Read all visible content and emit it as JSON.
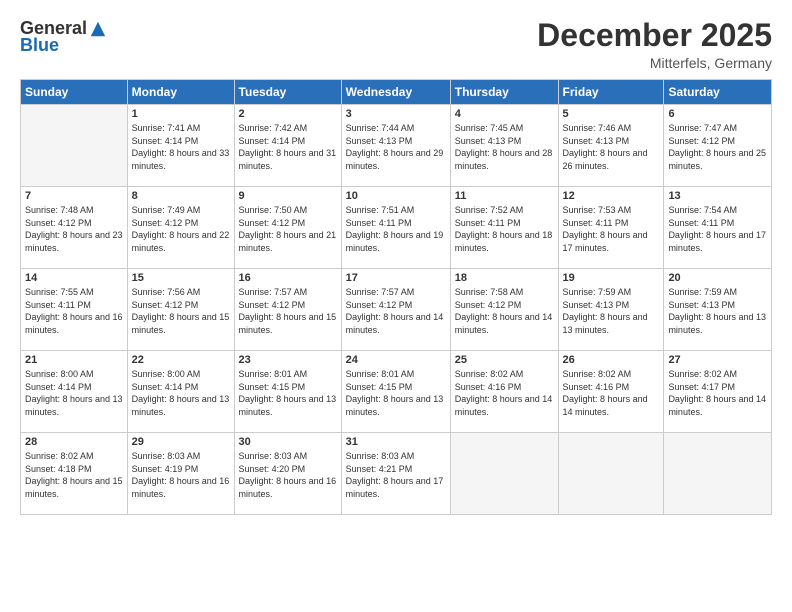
{
  "header": {
    "logo_general": "General",
    "logo_blue": "Blue",
    "month_title": "December 2025",
    "location": "Mitterfels, Germany"
  },
  "weekdays": [
    "Sunday",
    "Monday",
    "Tuesday",
    "Wednesday",
    "Thursday",
    "Friday",
    "Saturday"
  ],
  "weeks": [
    [
      {
        "day": "",
        "sunrise": "",
        "sunset": "",
        "daylight": ""
      },
      {
        "day": "1",
        "sunrise": "Sunrise: 7:41 AM",
        "sunset": "Sunset: 4:14 PM",
        "daylight": "Daylight: 8 hours and 33 minutes."
      },
      {
        "day": "2",
        "sunrise": "Sunrise: 7:42 AM",
        "sunset": "Sunset: 4:14 PM",
        "daylight": "Daylight: 8 hours and 31 minutes."
      },
      {
        "day": "3",
        "sunrise": "Sunrise: 7:44 AM",
        "sunset": "Sunset: 4:13 PM",
        "daylight": "Daylight: 8 hours and 29 minutes."
      },
      {
        "day": "4",
        "sunrise": "Sunrise: 7:45 AM",
        "sunset": "Sunset: 4:13 PM",
        "daylight": "Daylight: 8 hours and 28 minutes."
      },
      {
        "day": "5",
        "sunrise": "Sunrise: 7:46 AM",
        "sunset": "Sunset: 4:13 PM",
        "daylight": "Daylight: 8 hours and 26 minutes."
      },
      {
        "day": "6",
        "sunrise": "Sunrise: 7:47 AM",
        "sunset": "Sunset: 4:12 PM",
        "daylight": "Daylight: 8 hours and 25 minutes."
      }
    ],
    [
      {
        "day": "7",
        "sunrise": "Sunrise: 7:48 AM",
        "sunset": "Sunset: 4:12 PM",
        "daylight": "Daylight: 8 hours and 23 minutes."
      },
      {
        "day": "8",
        "sunrise": "Sunrise: 7:49 AM",
        "sunset": "Sunset: 4:12 PM",
        "daylight": "Daylight: 8 hours and 22 minutes."
      },
      {
        "day": "9",
        "sunrise": "Sunrise: 7:50 AM",
        "sunset": "Sunset: 4:12 PM",
        "daylight": "Daylight: 8 hours and 21 minutes."
      },
      {
        "day": "10",
        "sunrise": "Sunrise: 7:51 AM",
        "sunset": "Sunset: 4:11 PM",
        "daylight": "Daylight: 8 hours and 19 minutes."
      },
      {
        "day": "11",
        "sunrise": "Sunrise: 7:52 AM",
        "sunset": "Sunset: 4:11 PM",
        "daylight": "Daylight: 8 hours and 18 minutes."
      },
      {
        "day": "12",
        "sunrise": "Sunrise: 7:53 AM",
        "sunset": "Sunset: 4:11 PM",
        "daylight": "Daylight: 8 hours and 17 minutes."
      },
      {
        "day": "13",
        "sunrise": "Sunrise: 7:54 AM",
        "sunset": "Sunset: 4:11 PM",
        "daylight": "Daylight: 8 hours and 17 minutes."
      }
    ],
    [
      {
        "day": "14",
        "sunrise": "Sunrise: 7:55 AM",
        "sunset": "Sunset: 4:11 PM",
        "daylight": "Daylight: 8 hours and 16 minutes."
      },
      {
        "day": "15",
        "sunrise": "Sunrise: 7:56 AM",
        "sunset": "Sunset: 4:12 PM",
        "daylight": "Daylight: 8 hours and 15 minutes."
      },
      {
        "day": "16",
        "sunrise": "Sunrise: 7:57 AM",
        "sunset": "Sunset: 4:12 PM",
        "daylight": "Daylight: 8 hours and 15 minutes."
      },
      {
        "day": "17",
        "sunrise": "Sunrise: 7:57 AM",
        "sunset": "Sunset: 4:12 PM",
        "daylight": "Daylight: 8 hours and 14 minutes."
      },
      {
        "day": "18",
        "sunrise": "Sunrise: 7:58 AM",
        "sunset": "Sunset: 4:12 PM",
        "daylight": "Daylight: 8 hours and 14 minutes."
      },
      {
        "day": "19",
        "sunrise": "Sunrise: 7:59 AM",
        "sunset": "Sunset: 4:13 PM",
        "daylight": "Daylight: 8 hours and 13 minutes."
      },
      {
        "day": "20",
        "sunrise": "Sunrise: 7:59 AM",
        "sunset": "Sunset: 4:13 PM",
        "daylight": "Daylight: 8 hours and 13 minutes."
      }
    ],
    [
      {
        "day": "21",
        "sunrise": "Sunrise: 8:00 AM",
        "sunset": "Sunset: 4:14 PM",
        "daylight": "Daylight: 8 hours and 13 minutes."
      },
      {
        "day": "22",
        "sunrise": "Sunrise: 8:00 AM",
        "sunset": "Sunset: 4:14 PM",
        "daylight": "Daylight: 8 hours and 13 minutes."
      },
      {
        "day": "23",
        "sunrise": "Sunrise: 8:01 AM",
        "sunset": "Sunset: 4:15 PM",
        "daylight": "Daylight: 8 hours and 13 minutes."
      },
      {
        "day": "24",
        "sunrise": "Sunrise: 8:01 AM",
        "sunset": "Sunset: 4:15 PM",
        "daylight": "Daylight: 8 hours and 13 minutes."
      },
      {
        "day": "25",
        "sunrise": "Sunrise: 8:02 AM",
        "sunset": "Sunset: 4:16 PM",
        "daylight": "Daylight: 8 hours and 14 minutes."
      },
      {
        "day": "26",
        "sunrise": "Sunrise: 8:02 AM",
        "sunset": "Sunset: 4:16 PM",
        "daylight": "Daylight: 8 hours and 14 minutes."
      },
      {
        "day": "27",
        "sunrise": "Sunrise: 8:02 AM",
        "sunset": "Sunset: 4:17 PM",
        "daylight": "Daylight: 8 hours and 14 minutes."
      }
    ],
    [
      {
        "day": "28",
        "sunrise": "Sunrise: 8:02 AM",
        "sunset": "Sunset: 4:18 PM",
        "daylight": "Daylight: 8 hours and 15 minutes."
      },
      {
        "day": "29",
        "sunrise": "Sunrise: 8:03 AM",
        "sunset": "Sunset: 4:19 PM",
        "daylight": "Daylight: 8 hours and 16 minutes."
      },
      {
        "day": "30",
        "sunrise": "Sunrise: 8:03 AM",
        "sunset": "Sunset: 4:20 PM",
        "daylight": "Daylight: 8 hours and 16 minutes."
      },
      {
        "day": "31",
        "sunrise": "Sunrise: 8:03 AM",
        "sunset": "Sunset: 4:21 PM",
        "daylight": "Daylight: 8 hours and 17 minutes."
      },
      {
        "day": "",
        "sunrise": "",
        "sunset": "",
        "daylight": ""
      },
      {
        "day": "",
        "sunrise": "",
        "sunset": "",
        "daylight": ""
      },
      {
        "day": "",
        "sunrise": "",
        "sunset": "",
        "daylight": ""
      }
    ]
  ]
}
